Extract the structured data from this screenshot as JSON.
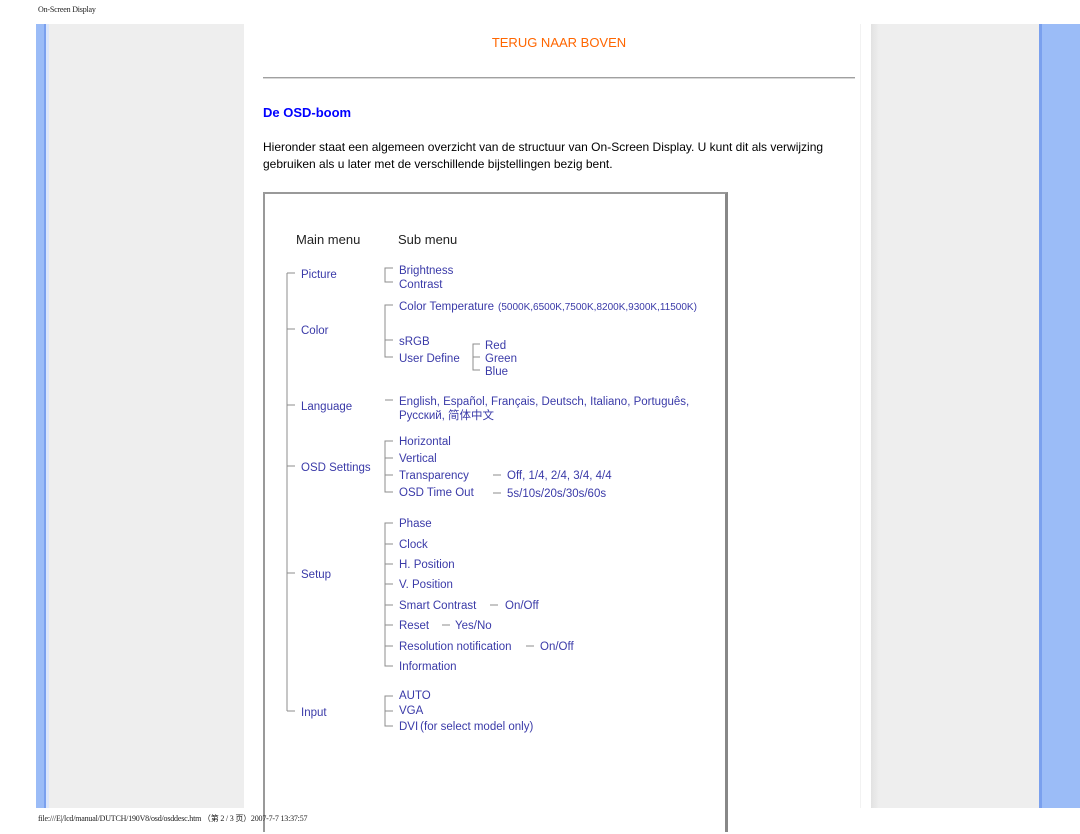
{
  "page_header": "On-Screen Display",
  "back_link": "TERUG NAAR BOVEN",
  "heading": "De OSD-boom",
  "intro": "Hieronder staat een algemeen overzicht van de structuur van On-Screen Display. U kunt dit als verwijzing gebruiken als u later met de verschillende bijstellingen bezig bent.",
  "colors": {
    "link": "#ff6600",
    "heading": "#0000ff",
    "tree_text": "#3a3aa8",
    "sidebar": "#9bbcf7"
  },
  "diagram": {
    "col_main": "Main menu",
    "col_sub": "Sub menu",
    "picture": {
      "label": "Picture",
      "items": [
        "Brightness",
        "Contrast"
      ]
    },
    "color": {
      "label": "Color",
      "items": [
        "Color Temperature",
        "sRGB",
        "User Define"
      ],
      "color_temperature_options": "(5000K,6500K,7500K,8200K,9300K,11500K)",
      "user_define_items": [
        "Red",
        "Green",
        "Blue"
      ]
    },
    "language": {
      "label": "Language",
      "line1": "English, Español, Français, Deutsch, Italiano, Português,",
      "line2": "Русский, 简体中文"
    },
    "osd_settings": {
      "label": "OSD Settings",
      "items": [
        "Horizontal",
        "Vertical",
        "Transparency",
        "OSD Time Out"
      ],
      "transparency_options": "Off, 1/4, 2/4, 3/4, 4/4",
      "timeout_options": "5s/10s/20s/30s/60s"
    },
    "setup": {
      "label": "Setup",
      "items": [
        "Phase",
        "Clock",
        "H. Position",
        "V. Position",
        "Smart Contrast",
        "Reset",
        "Resolution notification",
        "Information"
      ],
      "smart_contrast_options": "On/Off",
      "reset_options": "Yes/No",
      "resolution_notification_options": "On/Off"
    },
    "input": {
      "label": "Input",
      "items": [
        "AUTO",
        "VGA",
        "DVI"
      ],
      "dvi_note": "(for select model only)"
    }
  },
  "footer": "file:///E|/lcd/manual/DUTCH/190V8/osd/osddesc.htm （第 2 / 3 页）2007-7-7 13:37:57"
}
